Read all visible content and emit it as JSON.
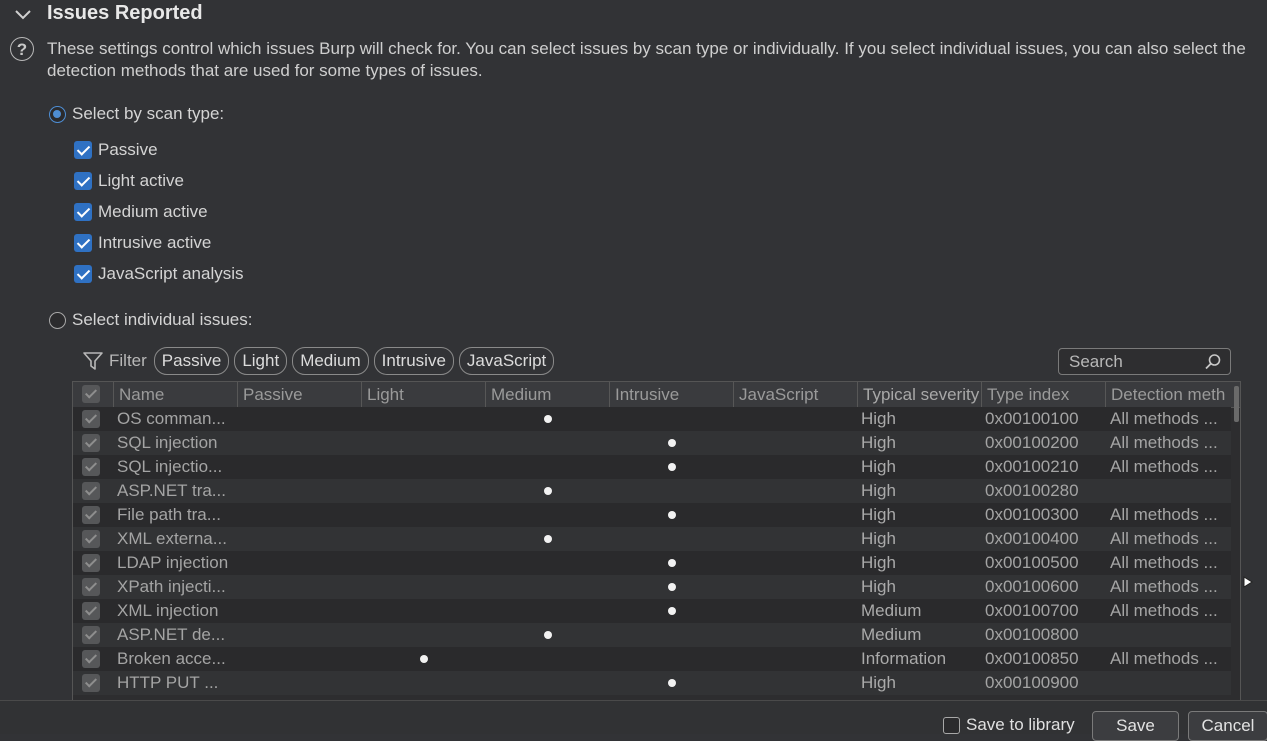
{
  "section": {
    "title": "Issues Reported",
    "description": "These settings control which issues Burp will check for. You can select issues by scan type or individually. If you select individual issues, you can also select the detection methods that are used for some types of issues."
  },
  "select_by_scan_type": {
    "label": "Select by scan type:",
    "selected": true,
    "options": [
      {
        "label": "Passive",
        "checked": true
      },
      {
        "label": "Light active",
        "checked": true
      },
      {
        "label": "Medium active",
        "checked": true
      },
      {
        "label": "Intrusive active",
        "checked": true
      },
      {
        "label": "JavaScript analysis",
        "checked": true
      }
    ]
  },
  "select_individual": {
    "label": "Select individual issues:",
    "selected": false
  },
  "filter": {
    "label": "Filter",
    "chips": [
      "Passive",
      "Light",
      "Medium",
      "Intrusive",
      "JavaScript"
    ]
  },
  "search": {
    "placeholder": "Search"
  },
  "table": {
    "columns": [
      "Name",
      "Passive",
      "Light",
      "Medium",
      "Intrusive",
      "JavaScript",
      "Typical severity",
      "Type index",
      "Detection meth"
    ],
    "rows": [
      {
        "name": "OS comman...",
        "scan": "Medium",
        "severity": "High",
        "type_index": "0x00100100",
        "detection": "All methods ..."
      },
      {
        "name": "SQL injection",
        "scan": "Intrusive",
        "severity": "High",
        "type_index": "0x00100200",
        "detection": "All methods ..."
      },
      {
        "name": "SQL injectio...",
        "scan": "Intrusive",
        "severity": "High",
        "type_index": "0x00100210",
        "detection": "All methods ..."
      },
      {
        "name": "ASP.NET tra...",
        "scan": "Medium",
        "severity": "High",
        "type_index": "0x00100280",
        "detection": ""
      },
      {
        "name": "File path tra...",
        "scan": "Intrusive",
        "severity": "High",
        "type_index": "0x00100300",
        "detection": "All methods ..."
      },
      {
        "name": "XML externa...",
        "scan": "Medium",
        "severity": "High",
        "type_index": "0x00100400",
        "detection": "All methods ..."
      },
      {
        "name": "LDAP injection",
        "scan": "Intrusive",
        "severity": "High",
        "type_index": "0x00100500",
        "detection": "All methods ..."
      },
      {
        "name": "XPath injecti...",
        "scan": "Intrusive",
        "severity": "High",
        "type_index": "0x00100600",
        "detection": "All methods ..."
      },
      {
        "name": "XML injection",
        "scan": "Intrusive",
        "severity": "Medium",
        "type_index": "0x00100700",
        "detection": "All methods ..."
      },
      {
        "name": "ASP.NET de...",
        "scan": "Medium",
        "severity": "Medium",
        "type_index": "0x00100800",
        "detection": ""
      },
      {
        "name": "Broken acce...",
        "scan": "Light",
        "severity": "Information",
        "type_index": "0x00100850",
        "detection": "All methods ..."
      },
      {
        "name": "HTTP PUT ...",
        "scan": "Intrusive",
        "severity": "High",
        "type_index": "0x00100900",
        "detection": ""
      }
    ]
  },
  "footer": {
    "save_to_library": "Save to library",
    "save": "Save",
    "cancel": "Cancel"
  }
}
